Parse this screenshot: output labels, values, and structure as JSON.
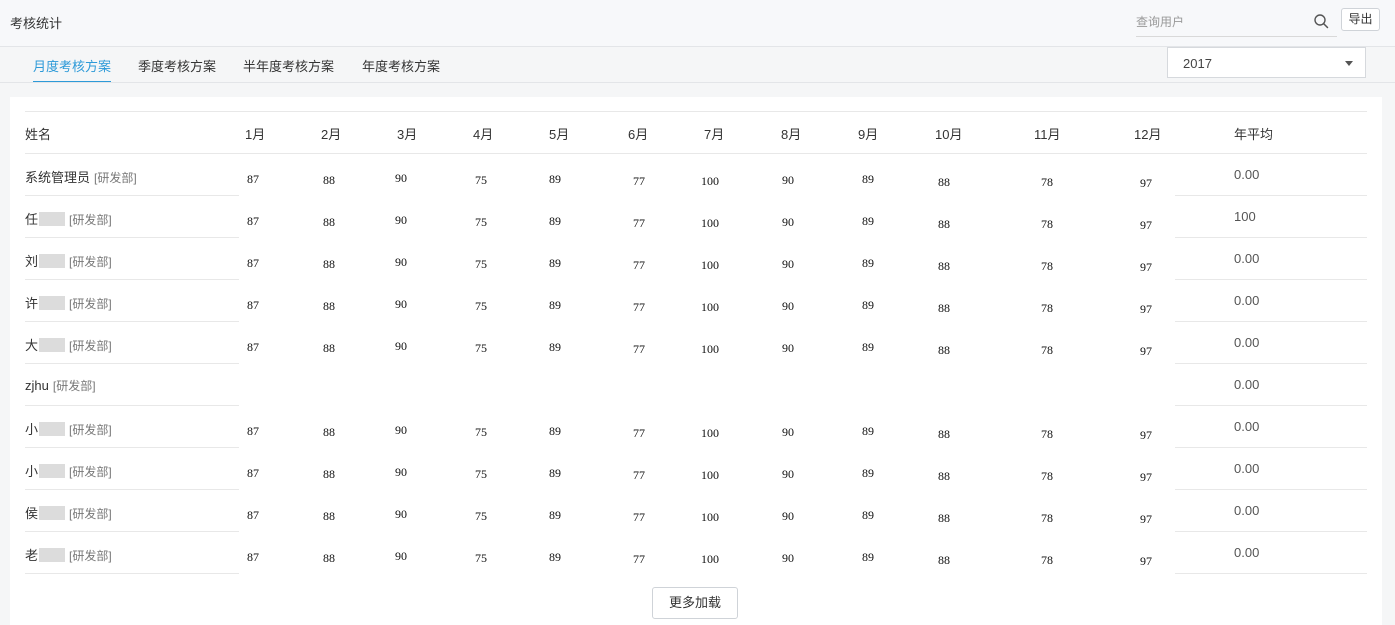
{
  "header": {
    "title": "考核统计",
    "search_placeholder": "查询用户",
    "search_value": "",
    "export_label": "导出"
  },
  "tabs": [
    {
      "label": "月度考核方案",
      "active": true
    },
    {
      "label": "季度考核方案",
      "active": false
    },
    {
      "label": "半年度考核方案",
      "active": false
    },
    {
      "label": "年度考核方案",
      "active": false
    }
  ],
  "year_select": {
    "value": "2017"
  },
  "table": {
    "columns": [
      "姓名",
      "1月",
      "2月",
      "3月",
      "4月",
      "5月",
      "6月",
      "7月",
      "8月",
      "9月",
      "10月",
      "11月",
      "12月",
      "年平均"
    ],
    "rows": [
      {
        "name": "系统管理员",
        "dept": "[研发部]",
        "blurred": false,
        "scores": [
          "87",
          "88",
          "90",
          "75",
          "89",
          "77",
          "100",
          "90",
          "89",
          "88",
          "78",
          "97"
        ],
        "avg": "0.00"
      },
      {
        "name": "任",
        "dept": "[研发部]",
        "blurred": true,
        "scores": [
          "87",
          "88",
          "90",
          "75",
          "89",
          "77",
          "100",
          "90",
          "89",
          "88",
          "78",
          "97"
        ],
        "avg": "100"
      },
      {
        "name": "刘",
        "dept": "[研发部]",
        "blurred": true,
        "scores": [
          "87",
          "88",
          "90",
          "75",
          "89",
          "77",
          "100",
          "90",
          "89",
          "88",
          "78",
          "97"
        ],
        "avg": "0.00"
      },
      {
        "name": "许",
        "dept": "[研发部]",
        "blurred": true,
        "scores": [
          "87",
          "88",
          "90",
          "75",
          "89",
          "77",
          "100",
          "90",
          "89",
          "88",
          "78",
          "97"
        ],
        "avg": "0.00"
      },
      {
        "name": "大",
        "dept": "[研发部]",
        "blurred": true,
        "scores": [
          "87",
          "88",
          "90",
          "75",
          "89",
          "77",
          "100",
          "90",
          "89",
          "88",
          "78",
          "97"
        ],
        "avg": "0.00"
      },
      {
        "name": "zjhu",
        "dept": "[研发部]",
        "blurred": false,
        "scores": [],
        "avg": "0.00"
      },
      {
        "name": "小",
        "dept": "[研发部]",
        "blurred": true,
        "scores": [
          "87",
          "88",
          "90",
          "75",
          "89",
          "77",
          "100",
          "90",
          "89",
          "88",
          "78",
          "97"
        ],
        "avg": "0.00"
      },
      {
        "name": "小",
        "dept": "[研发部]",
        "blurred": true,
        "scores": [
          "87",
          "88",
          "90",
          "75",
          "89",
          "77",
          "100",
          "90",
          "89",
          "88",
          "78",
          "97"
        ],
        "avg": "0.00"
      },
      {
        "name": "侯",
        "dept": "[研发部]",
        "blurred": true,
        "scores": [
          "87",
          "88",
          "90",
          "75",
          "89",
          "77",
          "100",
          "90",
          "89",
          "88",
          "78",
          "97"
        ],
        "avg": "0.00"
      },
      {
        "name": "老",
        "dept": "[研发部]",
        "blurred": true,
        "scores": [
          "87",
          "88",
          "90",
          "75",
          "89",
          "77",
          "100",
          "90",
          "89",
          "88",
          "78",
          "97"
        ],
        "avg": "0.00"
      }
    ]
  },
  "load_more_label": "更多加载"
}
